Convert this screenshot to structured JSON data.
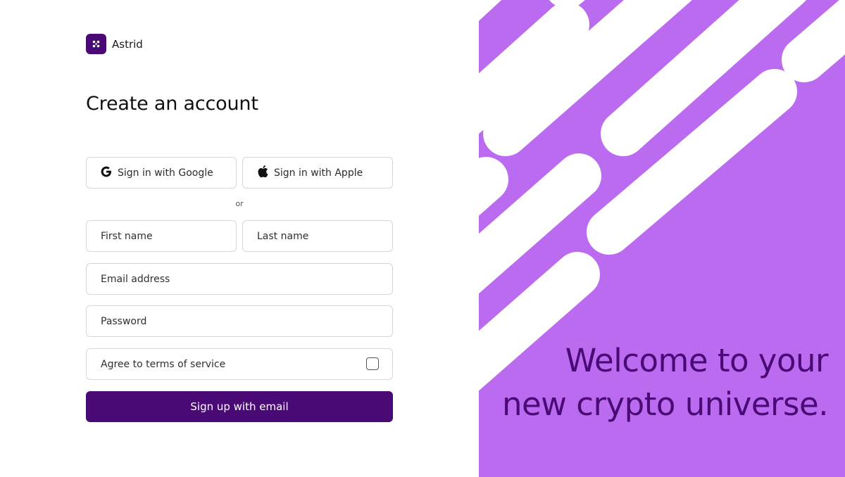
{
  "brand": {
    "name": "Astrid",
    "logo_icon": "four-dots-icon",
    "color": "#4a0a75"
  },
  "page": {
    "title": "Create an account"
  },
  "sso": {
    "google_label": "Sign in with Google",
    "apple_label": "Sign in with Apple"
  },
  "divider": {
    "label": "or"
  },
  "form": {
    "first_name_placeholder": "First name",
    "last_name_placeholder": "Last name",
    "email_placeholder": "Email address",
    "password_placeholder": "Password",
    "terms_label": "Agree to terms of service",
    "terms_checked": false,
    "submit_label": "Sign up with email"
  },
  "hero": {
    "line1": "Welcome to your",
    "line2": "new crypto universe.",
    "background": "#bb6bef",
    "text_color": "#4a0a75"
  }
}
